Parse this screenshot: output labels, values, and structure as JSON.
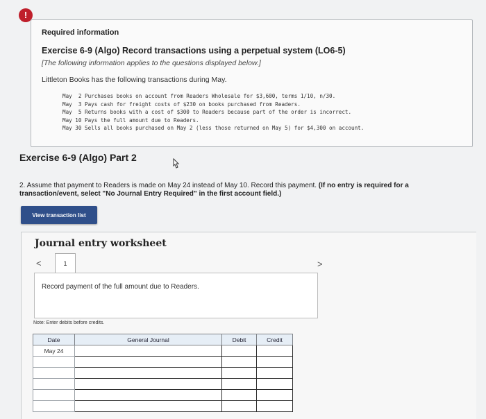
{
  "alert": {
    "symbol": "!"
  },
  "info": {
    "heading": "Required information",
    "title": "Exercise 6-9 (Algo) Record transactions using a perpetual system (LO6-5)",
    "note": "[The following information applies to the questions displayed below.]",
    "intro": "Littleton Books has the following transactions during May.",
    "transactions": [
      "May  2 Purchases books on account from Readers Wholesale for $3,600, terms 1/10, n/30.",
      "May  3 Pays cash for freight costs of $230 on books purchased from Readers.",
      "May  5 Returns books with a cost of $300 to Readers because part of the order is incorrect.",
      "May 10 Pays the full amount due to Readers.",
      "May 30 Sells all books purchased on May 2 (less those returned on May 5) for $4,300 on account."
    ]
  },
  "part": {
    "title": "Exercise 6-9 (Algo) Part 2",
    "instruction": "2. Assume that payment to Readers is made on May 24 instead of May 10. Record this payment.",
    "instruction_bold": "(If no entry is required for a transaction/event, select \"No Journal Entry Required\" in the first account field.)"
  },
  "buttons": {
    "view_transaction_list": "View transaction list"
  },
  "worksheet": {
    "title": "Journal entry worksheet",
    "prev_symbol": "<",
    "next_symbol": ">",
    "tab_number": "1",
    "description": "Record payment of the full amount due to Readers.",
    "note": "Note: Enter debits before credits.",
    "columns": {
      "date": "Date",
      "account": "General Journal",
      "debit": "Debit",
      "credit": "Credit"
    },
    "rows": [
      {
        "date": "May 24"
      },
      {
        "date": ""
      },
      {
        "date": ""
      },
      {
        "date": ""
      },
      {
        "date": ""
      },
      {
        "date": ""
      }
    ]
  }
}
